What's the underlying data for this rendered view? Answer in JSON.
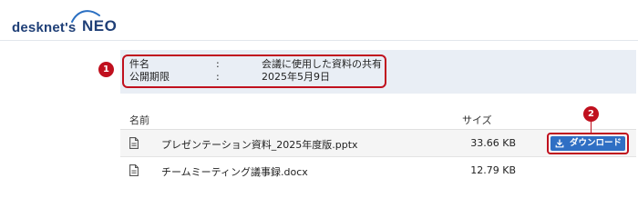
{
  "header": {
    "logo_desk": "desknet's",
    "logo_neo": "NEO"
  },
  "info": {
    "subject_label": "件名",
    "subject_sep": ":",
    "subject_value": "会議に使用した資料の共有",
    "period_label": "公開期限",
    "period_sep": ":",
    "period_value": "2025年5月9日"
  },
  "annotations": {
    "badge1": "1",
    "badge2": "2",
    "color": "#c0101e"
  },
  "table": {
    "columns": {
      "name": "名前",
      "size": "サイズ"
    },
    "rows": [
      {
        "name": "プレゼンテーション資料_2025年度版.pptx",
        "size": "33.66 KB",
        "icon": "document-icon"
      },
      {
        "name": "チームミーティング議事録.docx",
        "size": "12.79 KB",
        "icon": "document-icon"
      }
    ]
  },
  "download_button": {
    "label": "ダウンロード",
    "icon": "download-icon",
    "color": "#2f6fc4"
  }
}
